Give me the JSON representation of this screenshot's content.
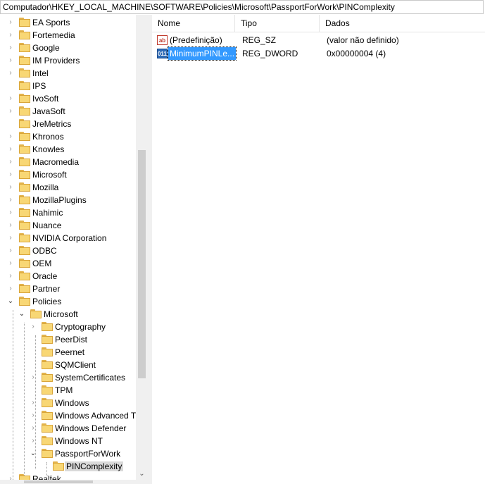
{
  "address_bar": {
    "path": "Computador\\HKEY_LOCAL_MACHINE\\SOFTWARE\\Policies\\Microsoft\\PassportForWork\\PINComplexity"
  },
  "tree": {
    "items": [
      {
        "label": "EA Sports",
        "expanded": false
      },
      {
        "label": "Fortemedia",
        "expanded": false
      },
      {
        "label": "Google",
        "expanded": false
      },
      {
        "label": "IM Providers",
        "expanded": false
      },
      {
        "label": "Intel",
        "expanded": false
      },
      {
        "label": "IPS",
        "expanded": false
      },
      {
        "label": "IvoSoft",
        "expanded": false
      },
      {
        "label": "JavaSoft",
        "expanded": false
      },
      {
        "label": "JreMetrics",
        "expanded": false
      },
      {
        "label": "Khronos",
        "expanded": false
      },
      {
        "label": "Knowles",
        "expanded": false
      },
      {
        "label": "Macromedia",
        "expanded": false
      },
      {
        "label": "Microsoft",
        "expanded": false
      },
      {
        "label": "Mozilla",
        "expanded": false
      },
      {
        "label": "MozillaPlugins",
        "expanded": false
      },
      {
        "label": "Nahimic",
        "expanded": false
      },
      {
        "label": "Nuance",
        "expanded": false
      },
      {
        "label": "NVIDIA Corporation",
        "expanded": false
      },
      {
        "label": "ODBC",
        "expanded": false
      },
      {
        "label": "OEM",
        "expanded": false
      },
      {
        "label": "Oracle",
        "expanded": false
      },
      {
        "label": "Partner",
        "expanded": false
      },
      {
        "label": "Policies",
        "expanded": true
      },
      {
        "label": "Microsoft",
        "expanded": true
      },
      {
        "label": "Cryptography",
        "expanded": false
      },
      {
        "label": "PeerDist",
        "expanded": false
      },
      {
        "label": "Peernet",
        "expanded": false
      },
      {
        "label": "SQMClient",
        "expanded": false
      },
      {
        "label": "SystemCertificates",
        "expanded": false
      },
      {
        "label": "TPM",
        "expanded": false
      },
      {
        "label": "Windows",
        "expanded": false
      },
      {
        "label": "Windows Advanced T",
        "expanded": false
      },
      {
        "label": "Windows Defender",
        "expanded": false
      },
      {
        "label": "Windows NT",
        "expanded": false
      },
      {
        "label": "PassportForWork",
        "expanded": true
      },
      {
        "label": "PINComplexity",
        "expanded": false,
        "selected": true
      },
      {
        "label": "Realtek",
        "expanded": false
      }
    ]
  },
  "values_pane": {
    "columns": [
      "Nome",
      "Tipo",
      "Dados"
    ],
    "rows": [
      {
        "icon": "string-value-icon",
        "icon_text": "ab",
        "name": "(Predefinição)",
        "type": "REG_SZ",
        "data": "(valor não definido)"
      },
      {
        "icon": "dword-value-icon",
        "icon_text": "011",
        "name": "MinimumPINLe...",
        "type": "REG_DWORD",
        "data": "0x00000004 (4)",
        "selected": true
      }
    ]
  },
  "icons": {
    "collapsed": "chevron-right-icon",
    "expanded": "chevron-down-icon",
    "folder": "folder-icon"
  },
  "colors": {
    "selection": "#3399ff",
    "folder": "#f8d775",
    "tree_selected": "#d9d9d9"
  }
}
